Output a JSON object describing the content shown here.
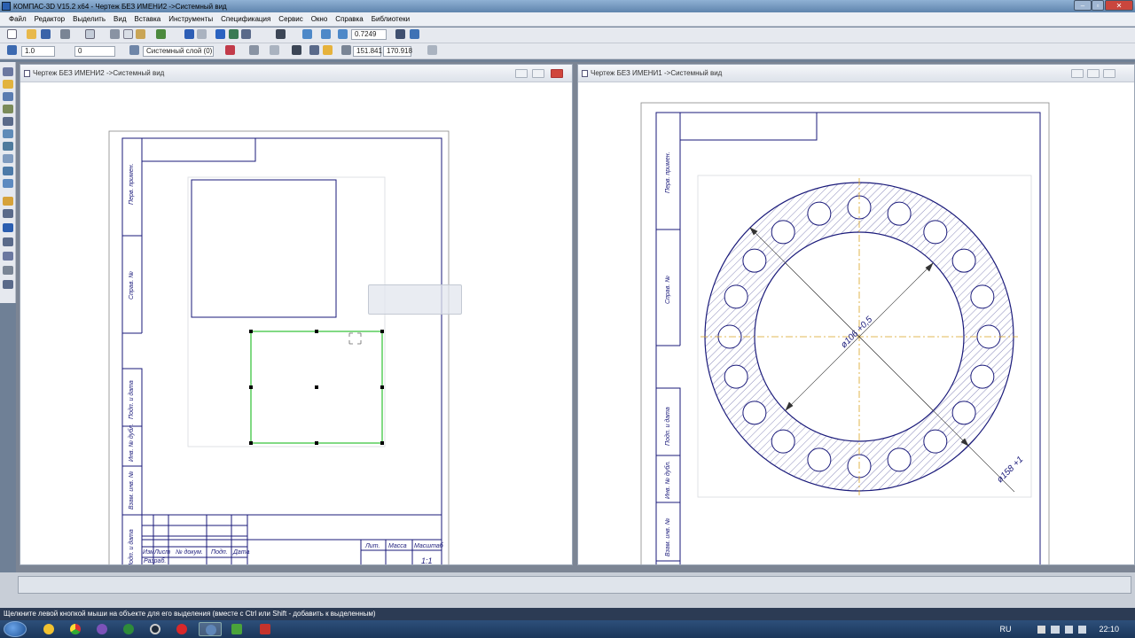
{
  "app": {
    "title": "КОМПАС-3D V15.2  x64 - Чертеж БЕЗ ИМЕНИ2 ->Системный вид"
  },
  "menu": [
    "Файл",
    "Редактор",
    "Выделить",
    "Вид",
    "Вставка",
    "Инструменты",
    "Спецификация",
    "Сервис",
    "Окно",
    "Справка",
    "Библиотеки"
  ],
  "toolbar": {
    "zoom_value": "0.7249",
    "line_scale": "1.0",
    "step_value": "0",
    "layer_value": "Системный слой (0)",
    "coord_x": "151.841",
    "coord_y": "170.918"
  },
  "windows": {
    "left_title": "Чертеж БЕЗ ИМЕНИ2 ->Системный вид",
    "right_title": "Чертеж БЕЗ ИМЕНИ1 ->Системный вид"
  },
  "stamp": {
    "sheet_side_labels": [
      "Перв. примен.",
      "Справ. №",
      "Подп. и дата",
      "Инв. № дубл.",
      "Взам. инв. №",
      "Подп. и дата"
    ],
    "right_side_labels": [
      "Перв. примен.",
      "Справ. №",
      "Подп. и дата",
      "Инв. № дубл.",
      "Взам. инв. №"
    ],
    "row_labels": [
      "Изм",
      "Лист",
      "№ докум.",
      "Подп.",
      "Дата"
    ],
    "razrab": "Разраб.",
    "lit_header": "Лит.",
    "mass_header": "Масса",
    "scale_header": "Масштаб",
    "scale_value": "1:1"
  },
  "drawing_right": {
    "dim_inner": "ø106 +0,5",
    "dim_outer": "ø158 +1",
    "hole_count": 20
  },
  "status": {
    "prompt": "Щелкните левой кнопкой мыши на объекте для его выделения (вместе с Ctrl или Shift - добавить к выделенным)"
  },
  "taskbar": {
    "lang": "RU",
    "time": "22:10"
  }
}
